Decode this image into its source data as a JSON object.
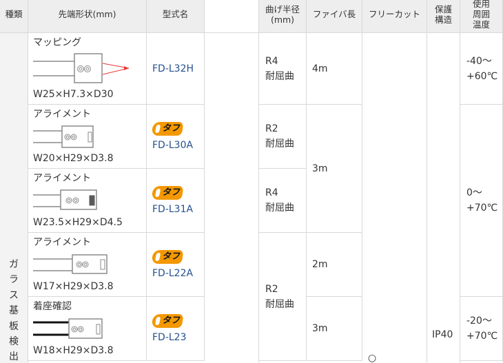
{
  "headers": {
    "type": "種類",
    "tip_shape": "先端形状(mm)",
    "model": "型式名",
    "bend_radius_line1": "曲げ半径",
    "bend_radius_line2": "(mm)",
    "fiber_length": "ファイバ長",
    "free_cut": "フリーカット",
    "protection_line1": "保護",
    "protection_line2": "構造",
    "temperature_line1": "使用",
    "temperature_line2": "周囲",
    "temperature_line3": "温度"
  },
  "category": "ガラス基板検出",
  "badge_label": "タフ",
  "rows": [
    {
      "shape_label": "マッピング",
      "dimensions": "W25×H7.3×D30",
      "model": "FD-L32H",
      "tough": false
    },
    {
      "shape_label": "アライメント",
      "dimensions": "W20×H29×D3.8",
      "model": "FD-L30A",
      "tough": true
    },
    {
      "shape_label": "アライメント",
      "dimensions": "W23.5×H29×D4.5",
      "model": "FD-L31A",
      "tough": true
    },
    {
      "shape_label": "アライメント",
      "dimensions": "W17×H29×D3.8",
      "model": "FD-L22A",
      "tough": true
    },
    {
      "shape_label": "着座確認",
      "dimensions": "W18×H29×D3.8",
      "model": "FD-L23",
      "tough": true
    }
  ],
  "bend_radius": [
    {
      "value": "R4",
      "note": "耐屈曲"
    },
    {
      "value": "R2",
      "note": "耐屈曲"
    },
    {
      "value": "R4",
      "note": "耐屈曲"
    },
    {
      "value": "R2",
      "note": "耐屈曲"
    }
  ],
  "fiber_length": [
    "4m",
    "3m",
    "2m",
    "3m"
  ],
  "free_cut": "○",
  "protection": "IP40",
  "temperature": [
    {
      "min": "-40～",
      "max": "+60℃"
    },
    {
      "min": "0～",
      "max": "+70℃"
    },
    {
      "min": "-20～",
      "max": "+70℃"
    }
  ],
  "colors": {
    "header_bg": "#eeeeee",
    "model_link": "#24508e",
    "tough_badge": "#f39800",
    "beam": "#e53935"
  }
}
